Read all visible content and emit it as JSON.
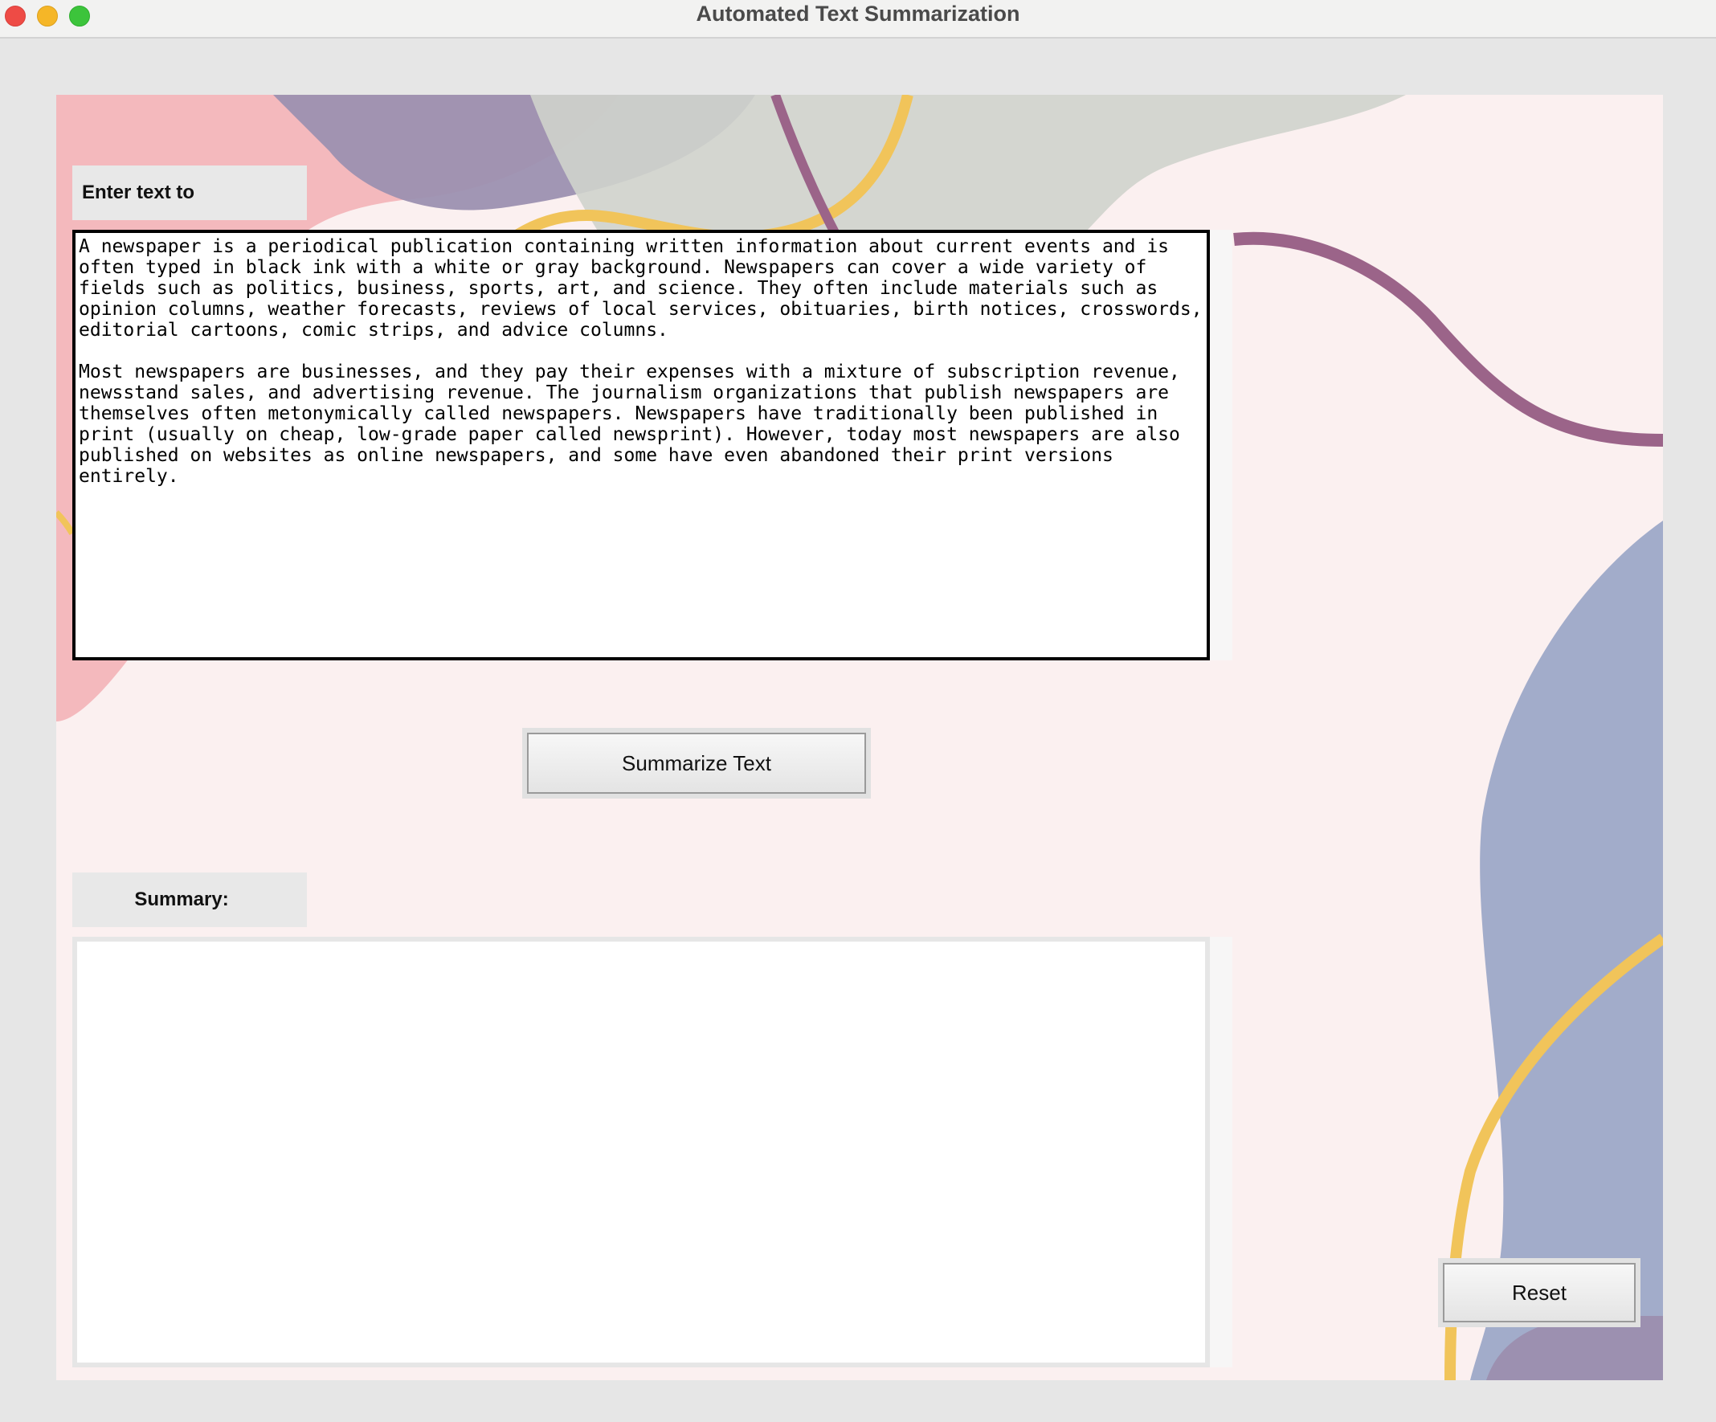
{
  "window": {
    "title": "Automated Text Summarization"
  },
  "input_section": {
    "label": "Enter text to summarize:",
    "text": "A newspaper is a periodical publication containing written information about current events and is often typed in black ink with a white or gray background. Newspapers can cover a wide variety of fields such as politics, business, sports, art, and science. They often include materials such as opinion columns, weather forecasts, reviews of local services, obituaries, birth notices, crosswords, editorial cartoons, comic strips, and advice columns.\n\nMost newspapers are businesses, and they pay their expenses with a mixture of subscription revenue, newsstand sales, and advertising revenue. The journalism organizations that publish newspapers are themselves often metonymically called newspapers. Newspapers have traditionally been published in print (usually on cheap, low-grade paper called newsprint). However, today most newspapers are also published on websites as online newspapers, and some have even abandoned their print versions entirely."
  },
  "actions": {
    "summarize_label": "Summarize Text",
    "reset_label": "Reset"
  },
  "summary_section": {
    "label": "Summary:",
    "text": ""
  },
  "colors": {
    "pink_blob": "#f4b9bd",
    "purple_blob": "#9c90b0",
    "gray_blob": "#d4d8d2",
    "blue_blob": "#a2acca",
    "yellow_line": "#f1c45a",
    "mauve_line": "#9b6489",
    "canvas_bg": "#fbf0f0"
  }
}
